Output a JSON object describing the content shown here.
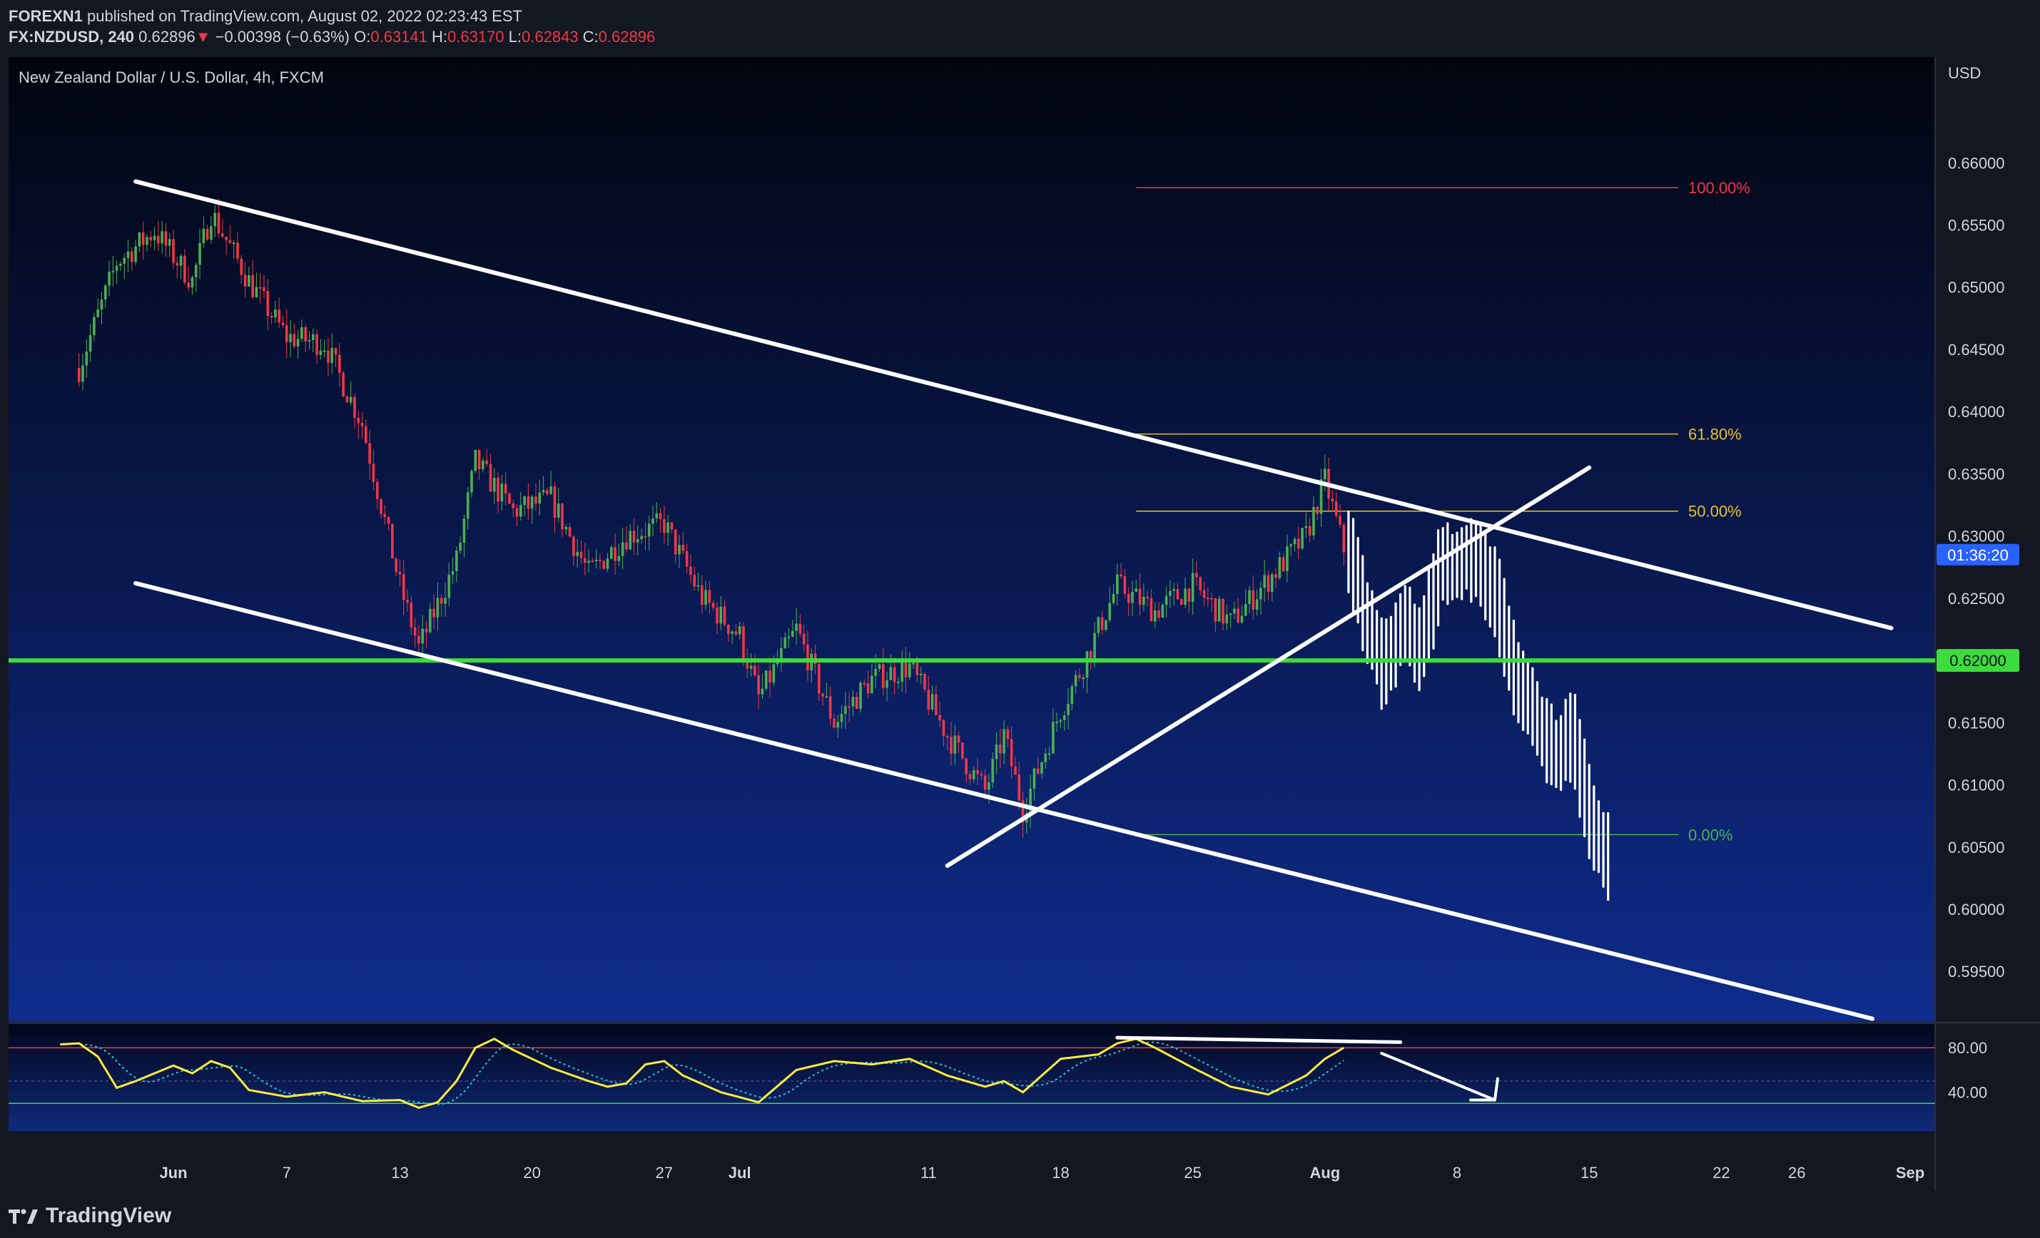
{
  "header": {
    "publisher": "FOREXN1",
    "published_text": "published on TradingView.com, August 02, 2022 02:23:43 EST",
    "symbol": "FX:NZDUSD, 240",
    "last": "0.62896",
    "arrow": "▼",
    "change": "−0.00398 (−0.63%)",
    "o_label": "O:",
    "o_value": "0.63141",
    "h_label": "H:",
    "h_value": "0.63170",
    "l_label": "L:",
    "l_value": "0.62843",
    "c_label": "C:",
    "c_value": "0.62896"
  },
  "footer": {
    "brand": "TradingView"
  },
  "colors": {
    "up": "#4caf50",
    "down": "#f23645",
    "support": "#3ddc3d",
    "fib_100": "#f23645",
    "fib_618": "#e6c229",
    "fib_50": "#e6c229",
    "fib_0": "#4caf50",
    "rsi": "#ffeb3b",
    "rsi_signal": "#26c6da",
    "timer_bg": "#2962ff"
  },
  "chart_data": [
    {
      "type": "candlestick",
      "title": "New Zealand Dollar / U.S. Dollar, 4h, FXCM",
      "currency_label": "USD",
      "y_ticks": [
        "0.66000",
        "0.65500",
        "0.65000",
        "0.64500",
        "0.64000",
        "0.63500",
        "0.63000",
        "0.62500",
        "0.61500",
        "0.61000",
        "0.60500",
        "0.60000",
        "0.59500"
      ],
      "ylim": [
        0.591,
        0.6685
      ],
      "x_ticks": [
        "Jun",
        "7",
        "13",
        "20",
        "27",
        "Jul",
        "11",
        "18",
        "25",
        "Aug",
        "8",
        "15",
        "22",
        "26",
        "Sep"
      ],
      "price_anchors": [
        [
          "2022-05-27",
          0.6435
        ],
        [
          "2022-05-29",
          0.652
        ],
        [
          "2022-05-31",
          0.6545
        ],
        [
          "2022-06-02",
          0.6505
        ],
        [
          "2022-06-03",
          0.656
        ],
        [
          "2022-06-05",
          0.6505
        ],
        [
          "2022-06-07",
          0.646
        ],
        [
          "2022-06-09",
          0.6455
        ],
        [
          "2022-06-11",
          0.639
        ],
        [
          "2022-06-13",
          0.626
        ],
        [
          "2022-06-14",
          0.621
        ],
        [
          "2022-06-16",
          0.628
        ],
        [
          "2022-06-17",
          0.636
        ],
        [
          "2022-06-19",
          0.632
        ],
        [
          "2022-06-21",
          0.633
        ],
        [
          "2022-06-23",
          0.627
        ],
        [
          "2022-06-25",
          0.63
        ],
        [
          "2022-06-27",
          0.631
        ],
        [
          "2022-06-29",
          0.625
        ],
        [
          "2022-07-01",
          0.622
        ],
        [
          "2022-07-02",
          0.617
        ],
        [
          "2022-07-04",
          0.6225
        ],
        [
          "2022-07-06",
          0.615
        ],
        [
          "2022-07-08",
          0.6185
        ],
        [
          "2022-07-10",
          0.6195
        ],
        [
          "2022-07-12",
          0.614
        ],
        [
          "2022-07-14",
          0.6095
        ],
        [
          "2022-07-15",
          0.614
        ],
        [
          "2022-07-16",
          0.608
        ],
        [
          "2022-07-18",
          0.616
        ],
        [
          "2022-07-19",
          0.619
        ],
        [
          "2022-07-21",
          0.626
        ],
        [
          "2022-07-23",
          0.624
        ],
        [
          "2022-07-25",
          0.626
        ],
        [
          "2022-07-27",
          0.623
        ],
        [
          "2022-07-29",
          0.6265
        ],
        [
          "2022-07-31",
          0.63
        ],
        [
          "2022-08-01",
          0.6345
        ],
        [
          "2022-08-02",
          0.62896
        ]
      ],
      "projection": [
        [
          "2022-08-02",
          0.6295
        ],
        [
          "2022-08-03",
          0.624
        ],
        [
          "2022-08-04",
          0.6195
        ],
        [
          "2022-08-05",
          0.623
        ],
        [
          "2022-08-06",
          0.621
        ],
        [
          "2022-08-07",
          0.6275
        ],
        [
          "2022-08-08",
          0.628
        ],
        [
          "2022-08-09",
          0.628
        ],
        [
          "2022-08-10",
          0.625
        ],
        [
          "2022-08-11",
          0.619
        ],
        [
          "2022-08-12",
          0.6155
        ],
        [
          "2022-08-13",
          0.6125
        ],
        [
          "2022-08-14",
          0.614
        ],
        [
          "2022-08-15",
          0.6065
        ],
        [
          "2022-08-16",
          0.604
        ]
      ],
      "support_level": 0.62,
      "support_label": "0.62000",
      "countdown_label": "01:36:20",
      "fibonacci": [
        {
          "label": "100.00%",
          "level": 0.658,
          "color": "#f23645"
        },
        {
          "label": "61.80%",
          "level": 0.6382,
          "color": "#e6c229"
        },
        {
          "label": "50.00%",
          "level": 0.632,
          "color": "#e6c229"
        },
        {
          "label": "0.00%",
          "level": 0.606,
          "color": "#4caf50"
        }
      ],
      "trendlines": [
        {
          "from": [
            "2022-05-30",
            0.6585
          ],
          "to": [
            "2022-08-31",
            0.6226
          ]
        },
        {
          "from": [
            "2022-05-30",
            0.6262
          ],
          "to": [
            "2022-08-30",
            0.5912
          ]
        },
        {
          "from": [
            "2022-07-12",
            0.6035
          ],
          "to": [
            "2022-08-15",
            0.6355
          ]
        }
      ]
    },
    {
      "type": "line",
      "series": [
        {
          "values": "rsi"
        },
        {
          "values": "rsi-signal"
        }
      ],
      "y_ticks": [
        "80.00",
        "40.00"
      ],
      "ylim": [
        0,
        100
      ],
      "bands": [
        80,
        50,
        30
      ],
      "rsi_anchors": [
        [
          "2022-05-26",
          83
        ],
        [
          "2022-05-27",
          84
        ],
        [
          "2022-05-28",
          72
        ],
        [
          "2022-05-29",
          44
        ],
        [
          "2022-05-30",
          50
        ],
        [
          "2022-06-01",
          64
        ],
        [
          "2022-06-02",
          57
        ],
        [
          "2022-06-03",
          68
        ],
        [
          "2022-06-04",
          62
        ],
        [
          "2022-06-05",
          42
        ],
        [
          "2022-06-07",
          36
        ],
        [
          "2022-06-09",
          40
        ],
        [
          "2022-06-11",
          32
        ],
        [
          "2022-06-13",
          33
        ],
        [
          "2022-06-14",
          26
        ],
        [
          "2022-06-15",
          31
        ],
        [
          "2022-06-16",
          50
        ],
        [
          "2022-06-17",
          80
        ],
        [
          "2022-06-18",
          88
        ],
        [
          "2022-06-19",
          78
        ],
        [
          "2022-06-21",
          62
        ],
        [
          "2022-06-23",
          50
        ],
        [
          "2022-06-24",
          45
        ],
        [
          "2022-06-25",
          48
        ],
        [
          "2022-06-26",
          65
        ],
        [
          "2022-06-27",
          68
        ],
        [
          "2022-06-28",
          55
        ],
        [
          "2022-06-30",
          40
        ],
        [
          "2022-07-02",
          31
        ],
        [
          "2022-07-04",
          60
        ],
        [
          "2022-07-06",
          68
        ],
        [
          "2022-07-08",
          65
        ],
        [
          "2022-07-10",
          70
        ],
        [
          "2022-07-12",
          55
        ],
        [
          "2022-07-14",
          45
        ],
        [
          "2022-07-15",
          50
        ],
        [
          "2022-07-16",
          40
        ],
        [
          "2022-07-18",
          70
        ],
        [
          "2022-07-20",
          74
        ],
        [
          "2022-07-21",
          84
        ],
        [
          "2022-07-22",
          88
        ],
        [
          "2022-07-23",
          80
        ],
        [
          "2022-07-25",
          62
        ],
        [
          "2022-07-27",
          45
        ],
        [
          "2022-07-29",
          38
        ],
        [
          "2022-07-31",
          55
        ],
        [
          "2022-08-01",
          70
        ],
        [
          "2022-08-02",
          80
        ]
      ],
      "divergence_line": {
        "from": [
          "2022-07-21",
          89
        ],
        "to": [
          "2022-08-05",
          85
        ]
      },
      "arrow": {
        "from": [
          "2022-08-04",
          75
        ],
        "to": [
          "2022-08-10",
          33
        ]
      }
    }
  ]
}
